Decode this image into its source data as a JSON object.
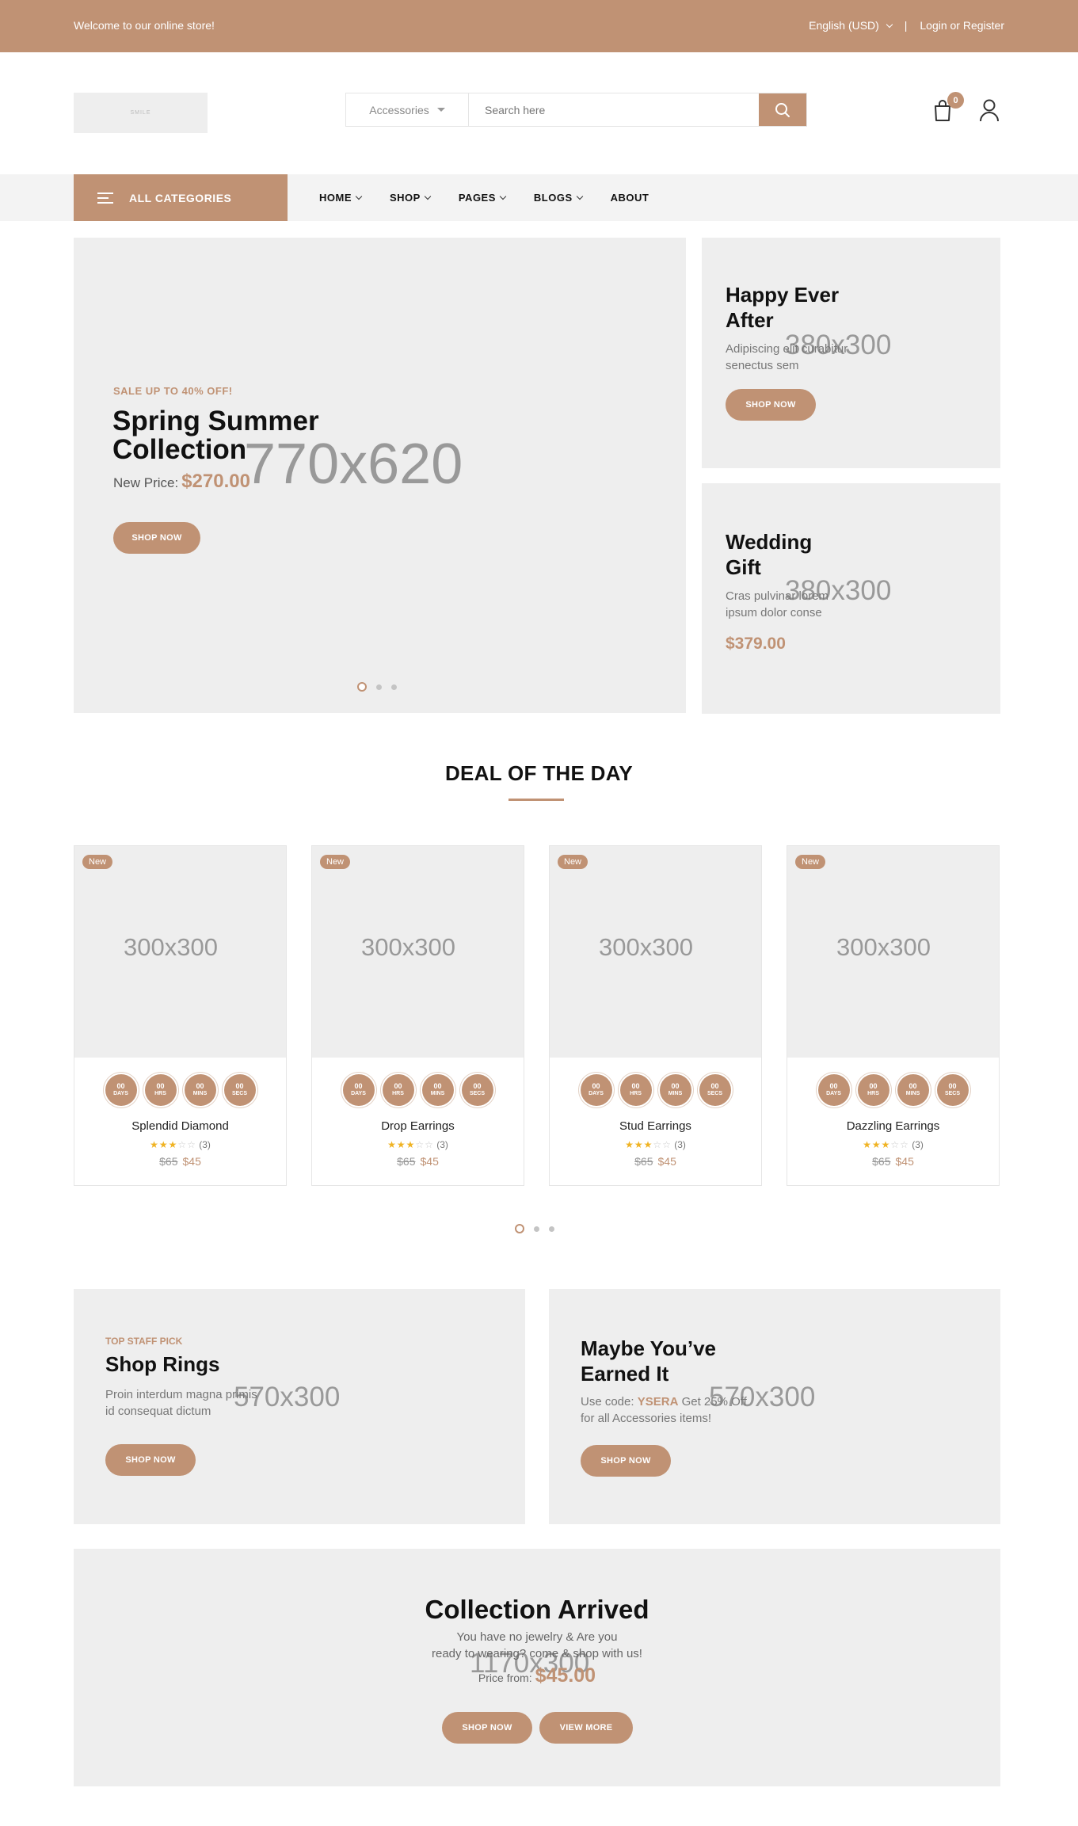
{
  "topbar": {
    "welcome": "Welcome to our online store!",
    "language": "English (USD)",
    "separator": "|",
    "login": "Login or Register"
  },
  "header": {
    "logo_text": "SMILE",
    "search_category": "Accessories",
    "search_placeholder": "Search here",
    "cart_count": "0"
  },
  "nav": {
    "all_categories": "ALL CATEGORIES",
    "items": [
      "HOME",
      "SHOP",
      "PAGES",
      "BLOGS",
      "ABOUT"
    ]
  },
  "hero": {
    "kicker": "SALE UP TO 40% OFF!",
    "title_line1": "Spring Summer",
    "title_line2": "Collection",
    "price_label": "New Price:",
    "price": "$270.00",
    "button": "SHOP NOW",
    "placeholder": "770x620"
  },
  "side_banners": [
    {
      "title_line1": "Happy Ever",
      "title_line2": "After",
      "text_line1": "Adipiscing elit curabitur",
      "text_line2": "senectus sem",
      "button": "SHOP NOW",
      "placeholder": "380x300"
    },
    {
      "title_line1": "Wedding",
      "title_line2": "Gift",
      "text_line1": "Cras pulvinar lorem",
      "text_line2": "ipsum dolor conse",
      "price": "$379.00",
      "placeholder": "380x300"
    }
  ],
  "deal": {
    "title": "DEAL OF THE DAY",
    "timer_labels": [
      "DAYS",
      "HRS",
      "MINS",
      "SECS"
    ],
    "timer_value": "00",
    "products": [
      {
        "badge": "New",
        "image": "300x300",
        "name": "Splendid Diamond",
        "reviews": "(3)",
        "old_price": "$65",
        "price": "$45",
        "rating": 3
      },
      {
        "badge": "New",
        "image": "300x300",
        "name": "Drop Earrings",
        "reviews": "(3)",
        "old_price": "$65",
        "price": "$45",
        "rating": 3
      },
      {
        "badge": "New",
        "image": "300x300",
        "name": "Stud Earrings",
        "reviews": "(3)",
        "old_price": "$65",
        "price": "$45",
        "rating": 3
      },
      {
        "badge": "New",
        "image": "300x300",
        "name": "Dazzling Earrings",
        "reviews": "(3)",
        "old_price": "$65",
        "price": "$45",
        "rating": 3
      }
    ]
  },
  "promos": [
    {
      "kicker": "TOP STAFF PICK",
      "title": "Shop Rings",
      "text_line1": "Proin interdum magna primis",
      "text_line2": "id consequat dictum",
      "button": "SHOP NOW",
      "placeholder": "570x300"
    },
    {
      "title_line1": "Maybe You’ve",
      "title_line2": "Earned It",
      "text_prefix": "Use code:",
      "code": "YSERA",
      "text_suffix": "Get 25% Off",
      "text_line2": "for all Accessories items!",
      "button": "SHOP NOW",
      "placeholder": "570x300"
    }
  ],
  "collection": {
    "title": "Collection Arrived",
    "text_line1": "You have no jewelry & Are you",
    "text_line2": "ready to wearing? come & shop with us!",
    "price_label": "Price from:",
    "price": "$45.00",
    "button_primary": "SHOP NOW",
    "button_secondary": "VIEW MORE",
    "placeholder": "1170x300"
  },
  "colors": {
    "accent": "#c09274",
    "panel": "#eeeeee",
    "star": "#f0b323"
  }
}
